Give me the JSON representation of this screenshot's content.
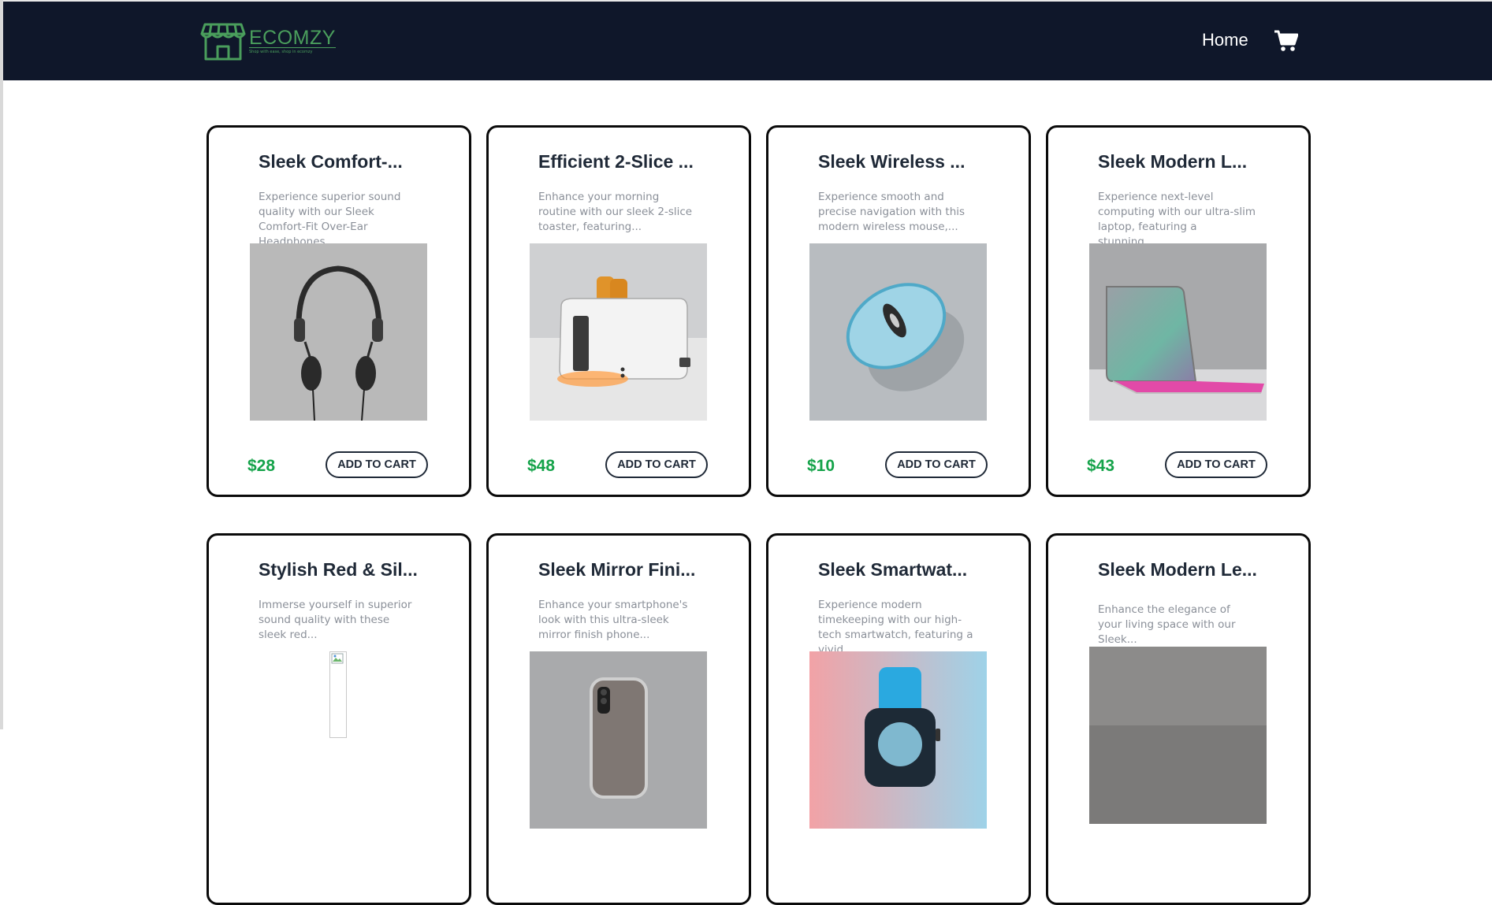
{
  "header": {
    "logo": {
      "name": "ECOMZY",
      "tagline": "Shop with ease, shop in ecomzy"
    },
    "nav": {
      "home_label": "Home"
    },
    "cart_icon": "shopping-cart-icon"
  },
  "colors": {
    "navbar_bg": "#0f172a",
    "logo_green": "#4a9e5c",
    "price_green": "#15a34a",
    "card_border": "#0a0a0a"
  },
  "products": [
    {
      "title": "Sleek Comfort-...",
      "description": "Experience superior sound quality with our Sleek Comfort-Fit Over-Ear Headphones,...",
      "price": "$28",
      "button_label": "ADD TO CART",
      "image": "headphones-image"
    },
    {
      "title": "Efficient 2-Slice ...",
      "description": "Enhance your morning routine with our sleek 2-slice toaster, featuring...",
      "price": "$48",
      "button_label": "ADD TO CART",
      "image": "toaster-image"
    },
    {
      "title": "Sleek Wireless ...",
      "description": "Experience smooth and precise navigation with this modern wireless mouse,...",
      "price": "$10",
      "button_label": "ADD TO CART",
      "image": "mouse-image"
    },
    {
      "title": "Sleek Modern L...",
      "description": "Experience next-level computing with our ultra-slim laptop, featuring a stunning...",
      "price": "$43",
      "button_label": "ADD TO CART",
      "image": "laptop-image"
    },
    {
      "title": "Stylish Red & Sil...",
      "description": "Immerse yourself in superior sound quality with these sleek red...",
      "image": "broken-image"
    },
    {
      "title": "Sleek Mirror Fini...",
      "description": "Enhance your smartphone's look with this ultra-sleek mirror finish phone...",
      "image": "phone-case-image"
    },
    {
      "title": "Sleek Smartwat...",
      "description": "Experience modern timekeeping with our high-tech smartwatch, featuring a vivid...",
      "image": "smartwatch-image"
    },
    {
      "title": "Sleek Modern Le...",
      "description": "Enhance the elegance of your living space with our Sleek...",
      "image": "furniture-image"
    }
  ]
}
